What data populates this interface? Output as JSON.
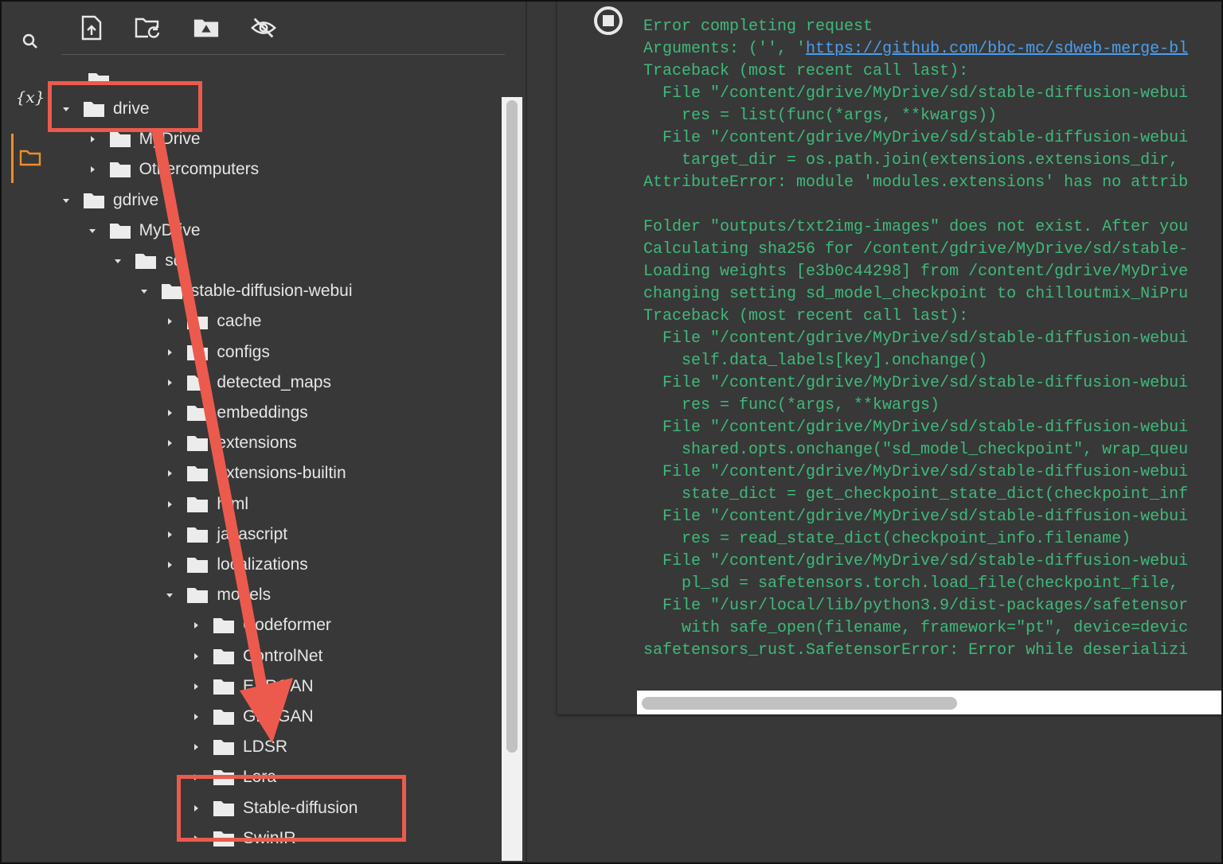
{
  "rail": {
    "items": [
      {
        "name": "search-icon",
        "active": false
      },
      {
        "name": "variables-icon",
        "label": "{x}",
        "active": false
      },
      {
        "name": "folder-icon",
        "active": true
      }
    ],
    "active_color": "#f28c28"
  },
  "toolbar": {
    "icons": [
      "upload-file-icon",
      "refresh-folder-icon",
      "mount-drive-icon",
      "hide-hidden-files-icon"
    ]
  },
  "file_tree": {
    "rows": [
      {
        "label": "drive",
        "expanded": true,
        "level": 0
      },
      {
        "label": "MyDrive",
        "expanded": false,
        "level": 1
      },
      {
        "label": "Othercomputers",
        "expanded": false,
        "level": 1
      },
      {
        "label": "gdrive",
        "expanded": true,
        "level": 0
      },
      {
        "label": "MyDrive",
        "expanded": true,
        "level": 1
      },
      {
        "label": "sd",
        "expanded": true,
        "level": 2
      },
      {
        "label": "stable-diffusion-webui",
        "expanded": true,
        "level": 3
      },
      {
        "label": "cache",
        "expanded": false,
        "level": 4
      },
      {
        "label": "configs",
        "expanded": false,
        "level": 4
      },
      {
        "label": "detected_maps",
        "expanded": false,
        "level": 4
      },
      {
        "label": "embeddings",
        "expanded": false,
        "level": 4
      },
      {
        "label": "extensions",
        "expanded": false,
        "level": 4
      },
      {
        "label": "extensions-builtin",
        "expanded": false,
        "level": 4
      },
      {
        "label": "html",
        "expanded": false,
        "level": 4
      },
      {
        "label": "javascript",
        "expanded": false,
        "level": 4
      },
      {
        "label": "localizations",
        "expanded": false,
        "level": 4
      },
      {
        "label": "models",
        "expanded": true,
        "level": 4
      },
      {
        "label": "Codeformer",
        "expanded": false,
        "level": 5
      },
      {
        "label": "ControlNet",
        "expanded": false,
        "level": 5
      },
      {
        "label": "ESRGAN",
        "expanded": false,
        "level": 5
      },
      {
        "label": "GFPGAN",
        "expanded": false,
        "level": 5
      },
      {
        "label": "LDSR",
        "expanded": false,
        "level": 5
      },
      {
        "label": "Lora",
        "expanded": false,
        "level": 5
      },
      {
        "label": "Stable-diffusion",
        "expanded": false,
        "level": 5
      },
      {
        "label": "SwinIR",
        "expanded": false,
        "level": 5
      }
    ]
  },
  "output": {
    "lines": [
      {
        "text": "Error completing request"
      },
      {
        "text": "Arguments: ('', '",
        "link": "https://github.com/bbc-mc/sdweb-merge-bl"
      },
      {
        "text": "Traceback (most recent call last):"
      },
      {
        "text": "  File \"/content/gdrive/MyDrive/sd/stable-diffusion-webui"
      },
      {
        "text": "    res = list(func(*args, **kwargs))"
      },
      {
        "text": "  File \"/content/gdrive/MyDrive/sd/stable-diffusion-webui"
      },
      {
        "text": "    target_dir = os.path.join(extensions.extensions_dir, "
      },
      {
        "text": "AttributeError: module 'modules.extensions' has no attrib"
      },
      {
        "text": ""
      },
      {
        "text": "Folder \"outputs/txt2img-images\" does not exist. After you"
      },
      {
        "text": "Calculating sha256 for /content/gdrive/MyDrive/sd/stable-"
      },
      {
        "text": "Loading weights [e3b0c44298] from /content/gdrive/MyDrive"
      },
      {
        "text": "changing setting sd_model_checkpoint to chilloutmix_NiPru"
      },
      {
        "text": "Traceback (most recent call last):"
      },
      {
        "text": "  File \"/content/gdrive/MyDrive/sd/stable-diffusion-webui"
      },
      {
        "text": "    self.data_labels[key].onchange()"
      },
      {
        "text": "  File \"/content/gdrive/MyDrive/sd/stable-diffusion-webui"
      },
      {
        "text": "    res = func(*args, **kwargs)"
      },
      {
        "text": "  File \"/content/gdrive/MyDrive/sd/stable-diffusion-webui"
      },
      {
        "text": "    shared.opts.onchange(\"sd_model_checkpoint\", wrap_queu"
      },
      {
        "text": "  File \"/content/gdrive/MyDrive/sd/stable-diffusion-webui"
      },
      {
        "text": "    state_dict = get_checkpoint_state_dict(checkpoint_inf"
      },
      {
        "text": "  File \"/content/gdrive/MyDrive/sd/stable-diffusion-webui"
      },
      {
        "text": "    res = read_state_dict(checkpoint_info.filename)"
      },
      {
        "text": "  File \"/content/gdrive/MyDrive/sd/stable-diffusion-webui"
      },
      {
        "text": "    pl_sd = safetensors.torch.load_file(checkpoint_file, "
      },
      {
        "text": "  File \"/usr/local/lib/python3.9/dist-packages/safetensor"
      },
      {
        "text": "    with safe_open(filename, framework=\"pt\", device=devic"
      },
      {
        "text": "safetensors_rust.SafetensorError: Error while deserializi"
      }
    ],
    "text_color": "#3fb97b",
    "link_color": "#4a9ef2"
  },
  "annotations": {
    "color": "#ec5a4e",
    "highlighted_items": [
      "drive",
      "Stable-diffusion"
    ]
  }
}
